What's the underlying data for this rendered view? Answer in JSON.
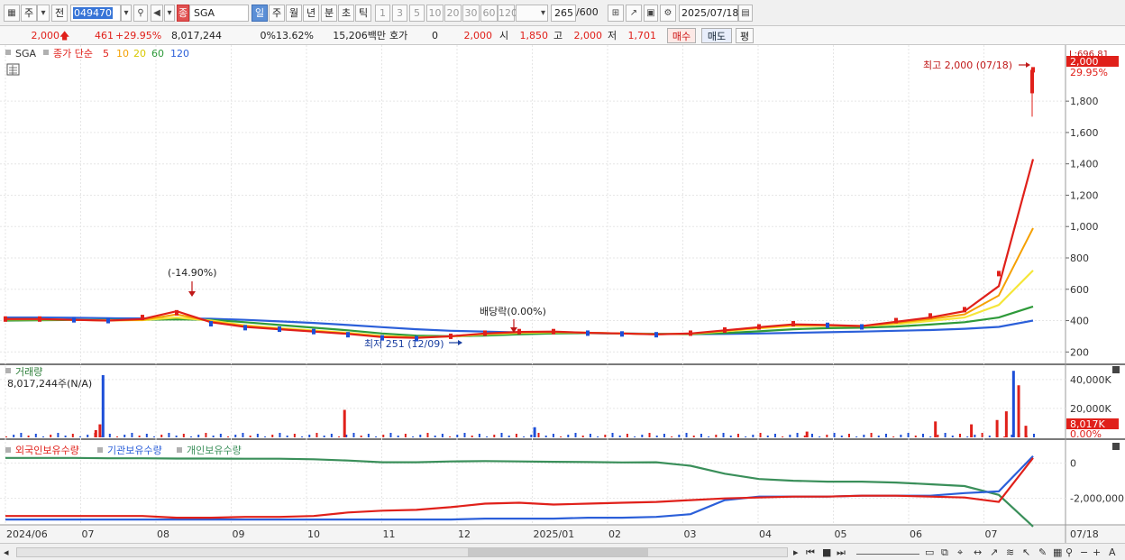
{
  "toolbar": {
    "tabs_left": [
      "주",
      "전"
    ],
    "stock_code": "049470",
    "stock_name": "SGA",
    "name_prefix": "종",
    "period_tabs": [
      "일",
      "주",
      "월",
      "년",
      "분",
      "초",
      "틱"
    ],
    "active_period": "일",
    "minute_options": [
      "1",
      "3",
      "5",
      "10",
      "20",
      "30",
      "60",
      "120"
    ],
    "count_value": "265",
    "count_max": "/600",
    "date": "2025/07/18"
  },
  "quote": {
    "price": "2,000",
    "change": "461",
    "change_pct": "+29.95%",
    "volume": "8,017,244",
    "zero_pct": "0%",
    "turnover_pct": "13.62%",
    "amount": "15,206백만",
    "hoga_label": "호가",
    "hoga_value": "0",
    "hoga_price": "2,000",
    "open_label": "시",
    "open": "1,850",
    "high_label": "고",
    "high": "2,000",
    "low_label": "저",
    "low": "1,701",
    "buy_label": "매수",
    "sell_label": "매도",
    "pyeong_label": "평"
  },
  "legend": {
    "symbol": "SGA",
    "ma_title": "종가 단순",
    "ma_periods": [
      "5",
      "10",
      "20",
      "60",
      "120"
    ],
    "volume_title": "거래량",
    "volume_value": "8,017,244주(N/A)",
    "holdings": [
      "외국인보유수량",
      "기관보유수량",
      "개인보유수량"
    ]
  },
  "annotations": {
    "high": "최고 2,000 (07/18)",
    "low": "최저 251 (12/09)",
    "drop": "(-14.90%)",
    "dividend": "배당락(0.00%)",
    "top_right": "L:696.81",
    "last_price_box": "2,000",
    "last_pct": "29.95%",
    "vol_box": "8,017K",
    "vol_pct": "0.00%"
  },
  "colors": {
    "up": "#e0201a",
    "down": "#1d4fd8",
    "ma5": "#e0201a",
    "ma10": "#f5a000",
    "ma20": "#f5e63a",
    "ma60": "#2e9a3a",
    "ma120": "#2b5fd9",
    "foreign": "#e0201a",
    "institution": "#2b5fd9",
    "individual": "#3a8f5a"
  },
  "chart_data": {
    "type": "line",
    "x_axis_labels": [
      "2024/06",
      "07",
      "08",
      "09",
      "10",
      "11",
      "12",
      "2025/01",
      "02",
      "03",
      "04",
      "05",
      "06",
      "07",
      "07/18"
    ],
    "price_axis": {
      "ylim": [
        150,
        2100
      ],
      "ticks": [
        200,
        400,
        600,
        800,
        "1,000",
        "1,200",
        "1,400",
        "1,600",
        "1,800"
      ]
    },
    "x_months": [
      0,
      1,
      2,
      3,
      4,
      5,
      6,
      7,
      8,
      9,
      10,
      11,
      12,
      13,
      13.6
    ],
    "close": [
      410,
      410,
      405,
      400,
      420,
      450,
      380,
      355,
      345,
      330,
      310,
      290,
      285,
      300,
      320,
      330,
      330,
      320,
      315,
      310,
      320,
      340,
      360,
      380,
      370,
      360,
      400,
      430,
      470,
      700,
      2000
    ],
    "ma5": [
      410,
      410,
      405,
      400,
      410,
      460,
      390,
      360,
      345,
      330,
      315,
      295,
      290,
      300,
      318,
      328,
      330,
      322,
      318,
      312,
      318,
      338,
      358,
      376,
      372,
      365,
      392,
      420,
      460,
      620,
      1430
    ],
    "ma10": [
      410,
      410,
      405,
      400,
      405,
      440,
      395,
      365,
      348,
      333,
      318,
      298,
      292,
      300,
      316,
      326,
      328,
      323,
      318,
      313,
      317,
      336,
      355,
      372,
      370,
      366,
      385,
      410,
      440,
      560,
      990
    ],
    "ma20": [
      408,
      408,
      405,
      402,
      403,
      420,
      400,
      370,
      352,
      337,
      322,
      302,
      294,
      298,
      312,
      322,
      326,
      322,
      318,
      314,
      316,
      332,
      350,
      366,
      367,
      365,
      378,
      398,
      420,
      500,
      720
    ],
    "ma60": [
      400,
      402,
      404,
      405,
      405,
      408,
      405,
      390,
      372,
      355,
      338,
      318,
      304,
      300,
      305,
      312,
      318,
      320,
      318,
      315,
      314,
      320,
      332,
      345,
      352,
      355,
      362,
      375,
      390,
      420,
      490
    ],
    "ma120": [
      420,
      420,
      418,
      415,
      414,
      414,
      412,
      405,
      395,
      385,
      372,
      358,
      345,
      335,
      330,
      325,
      322,
      320,
      318,
      316,
      314,
      315,
      318,
      322,
      326,
      330,
      335,
      340,
      348,
      360,
      400
    ],
    "volume_axis": {
      "ticks": [
        "40,000K",
        "20,000K"
      ]
    },
    "volume_spikes": [
      {
        "pos": 0.095,
        "value": 43000,
        "dir": "down"
      },
      {
        "pos": 0.092,
        "value": 9000,
        "dir": "up"
      },
      {
        "pos": 0.088,
        "value": 5000,
        "dir": "up"
      },
      {
        "pos": 0.33,
        "value": 19000,
        "dir": "up"
      },
      {
        "pos": 0.515,
        "value": 7000,
        "dir": "down"
      },
      {
        "pos": 0.78,
        "value": 4000,
        "dir": "up"
      },
      {
        "pos": 0.905,
        "value": 11000,
        "dir": "up"
      },
      {
        "pos": 0.94,
        "value": 9000,
        "dir": "up"
      },
      {
        "pos": 0.965,
        "value": 12000,
        "dir": "up"
      },
      {
        "pos": 0.974,
        "value": 18000,
        "dir": "up"
      },
      {
        "pos": 0.981,
        "value": 46000,
        "dir": "down"
      },
      {
        "pos": 0.986,
        "value": 36000,
        "dir": "up"
      },
      {
        "pos": 0.993,
        "value": 8017,
        "dir": "up"
      }
    ],
    "holdings_axis": {
      "ticks": [
        "0",
        "-2,000,000"
      ]
    },
    "foreign": [
      -3000000,
      -3000000,
      -3000000,
      -3000000,
      -3000000,
      -3100000,
      -3100000,
      -3050000,
      -3050000,
      -3000000,
      -2800000,
      -2700000,
      -2650000,
      -2500000,
      -2300000,
      -2250000,
      -2350000,
      -2300000,
      -2250000,
      -2200000,
      -2100000,
      -2000000,
      -1950000,
      -1900000,
      -1900000,
      -1850000,
      -1850000,
      -1900000,
      -1950000,
      -2200000,
      300000
    ],
    "institution": [
      -3200000,
      -3200000,
      -3200000,
      -3200000,
      -3200000,
      -3200000,
      -3200000,
      -3200000,
      -3200000,
      -3200000,
      -3200000,
      -3200000,
      -3200000,
      -3200000,
      -3150000,
      -3150000,
      -3150000,
      -3100000,
      -3100000,
      -3050000,
      -2900000,
      -2100000,
      -1900000,
      -1900000,
      -1900000,
      -1850000,
      -1850000,
      -1850000,
      -1700000,
      -1600000,
      400000
    ],
    "individual": [
      300000,
      300000,
      300000,
      280000,
      280000,
      260000,
      260000,
      250000,
      250000,
      220000,
      150000,
      50000,
      50000,
      100000,
      120000,
      100000,
      80000,
      60000,
      40000,
      50000,
      -150000,
      -600000,
      -900000,
      -1000000,
      -1050000,
      -1050000,
      -1100000,
      -1200000,
      -1300000,
      -1800000,
      -3600000
    ]
  }
}
